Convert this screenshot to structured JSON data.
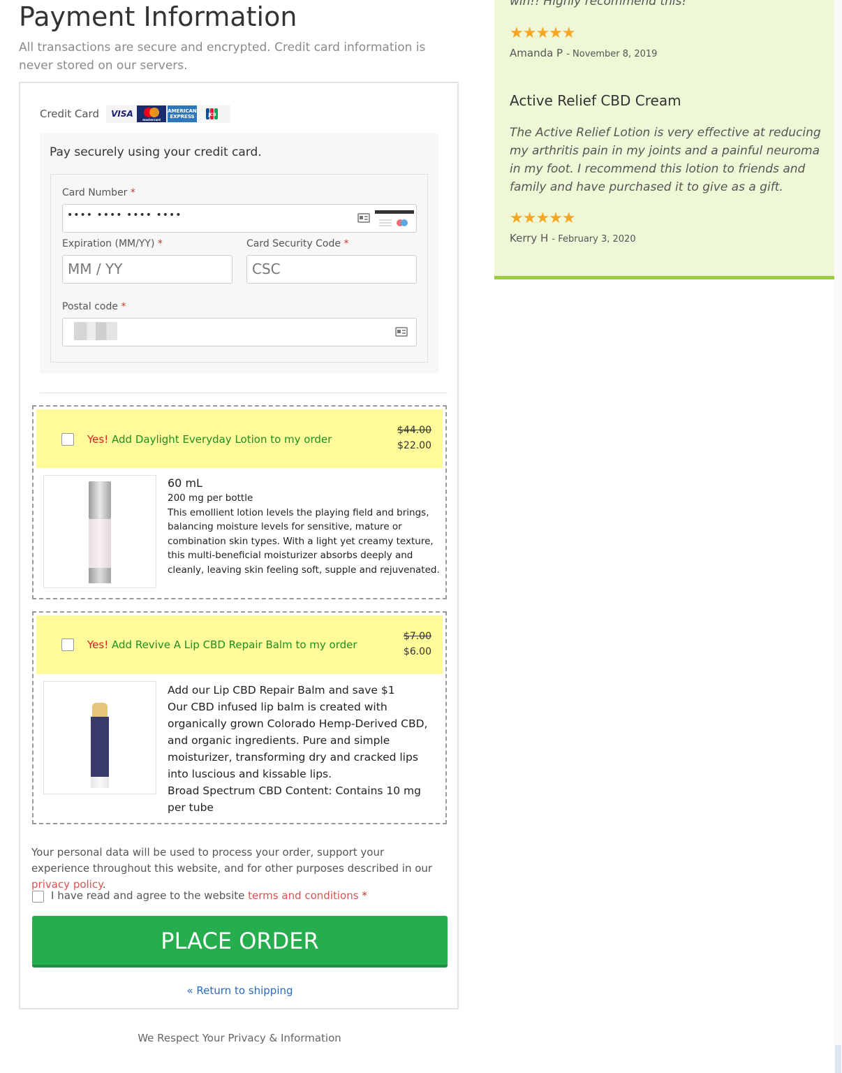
{
  "payment": {
    "title": "Payment Information",
    "subtitle": "All transactions are secure and encrypted. Credit card information is never stored on our servers.",
    "method_label": "Credit Card",
    "card_logos": [
      "VISA",
      "mastercard",
      "AMERICAN EXPRESS",
      "JCB"
    ],
    "description": "Pay securely using your credit card.",
    "card_number": {
      "label": "Card Number",
      "value": "•••• •••• •••• ••••"
    },
    "expiration": {
      "label": "Expiration (MM/YY)",
      "placeholder": "MM / YY"
    },
    "csc": {
      "label": "Card Security Code",
      "placeholder": "CSC"
    },
    "postal": {
      "label": "Postal code"
    },
    "required_mark": "*"
  },
  "upsells": [
    {
      "yes": "Yes!",
      "text": "Add Daylight Everyday Lotion to my order",
      "old_price": "$44.00",
      "new_price": "$22.00",
      "headline": "60 mL",
      "lines": [
        "200 mg per bottle",
        "This emollient lotion levels the playing field and brings, balancing moisture levels for sensitive, mature or combination skin types. With a light yet creamy texture, this multi-beneficial moisturizer absorbs deeply and cleanly, leaving skin feeling soft, supple and rejuvenated."
      ]
    },
    {
      "yes": "Yes!",
      "text": "Add Revive A Lip CBD Repair Balm to my order",
      "old_price": "$7.00",
      "new_price": "$6.00",
      "headline": "Add our Lip CBD Repair Balm and save $1",
      "lines": [
        "Our CBD infused lip balm is created with organically grown Colorado Hemp-Derived CBD, and organic ingredients. Pure and simple moisturizer, transforming dry and cracked lips into luscious and kissable lips.",
        "Broad Spectrum CBD Content: Contains 10 mg per tube"
      ]
    }
  ],
  "privacy": {
    "text": "Your personal data will be used to process your order, support your experience throughout this website, and for other purposes described in our ",
    "link": "privacy policy",
    "end": "."
  },
  "terms": {
    "text": "I have read and agree to the website ",
    "link": "terms and conditions",
    "req": "*"
  },
  "place_order": "PLACE ORDER",
  "return_link": "« Return to shipping",
  "footer_note": "We Respect Your Privacy & Information",
  "reviews": {
    "top_quote": "win!! Highly recommend this!",
    "review1": {
      "stars": "★★★★★",
      "author": "Amanda P",
      "date": "- November 8, 2019"
    },
    "review2": {
      "title": "Active Relief CBD Cream",
      "text": "The Active Relief Lotion is very effective at reducing my arthritis pain in my joints and a painful neuroma in my foot. I recommend this lotion to friends and family and have purchased it to give as a gift.",
      "stars": "★★★★★",
      "author": "Kerry H",
      "date": "- February 3, 2020"
    }
  },
  "colors": {
    "accent_green": "#25ad4e",
    "review_bg": "#eef8d6",
    "upsell_bg": "#fffb9a",
    "link_red": "#d9534f",
    "link_blue": "#2a6bbf",
    "star": "#f5a623"
  }
}
